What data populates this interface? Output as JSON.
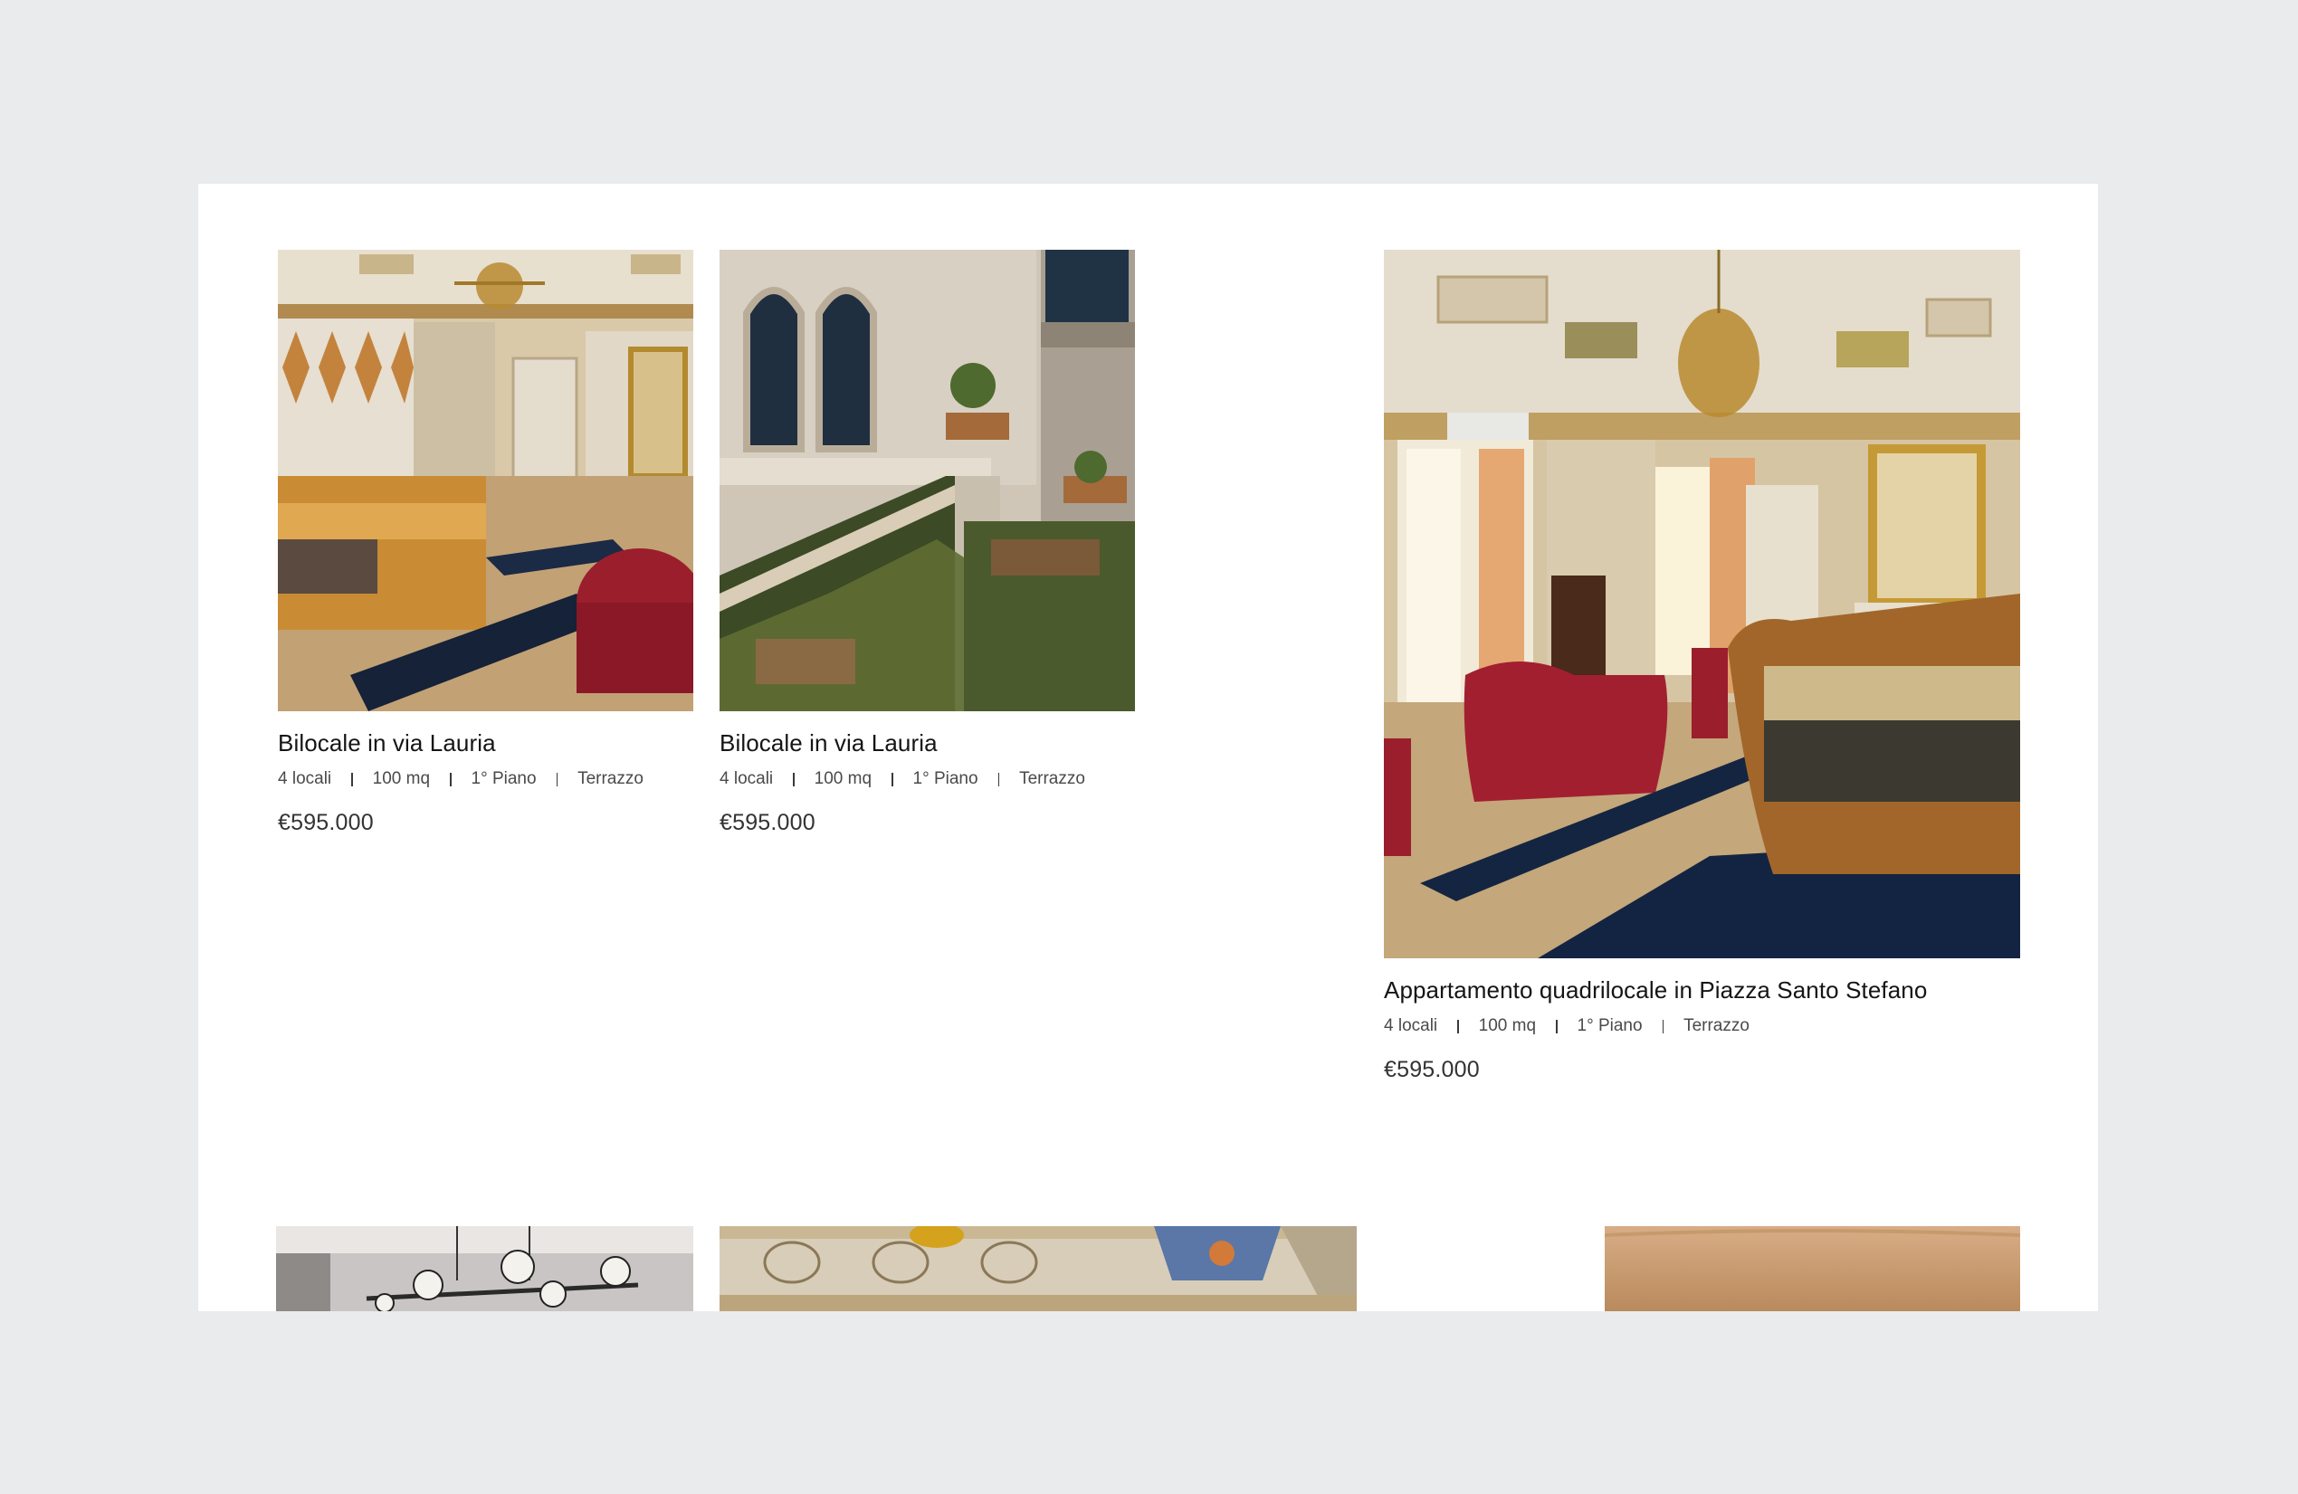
{
  "listings": [
    {
      "title": "Bilocale in via Lauria",
      "rooms": "4 locali",
      "size": "100 mq",
      "floor": "1° Piano",
      "feature": "Terrazzo",
      "price": "€595.000",
      "image": "bedroom-interior"
    },
    {
      "title": "Bilocale in via Lauria",
      "rooms": "4 locali",
      "size": "100 mq",
      "floor": "1° Piano",
      "feature": "Terrazzo",
      "price": "€595.000",
      "image": "palazzo-staircase-exterior"
    },
    {
      "title": "Appartamento quadrilocale in Piazza Santo Stefano",
      "rooms": "4 locali",
      "size": "100 mq",
      "floor": "1° Piano",
      "feature": "Terrazzo",
      "price": "€595.000",
      "image": "grand-bedroom-interior"
    }
  ],
  "next_row_images": [
    "modern-chandelier",
    "frescoed-ceiling",
    "warm-ceiling"
  ],
  "colors": {
    "background": "#eaebed",
    "panel": "#ffffff",
    "text": "#151515"
  }
}
